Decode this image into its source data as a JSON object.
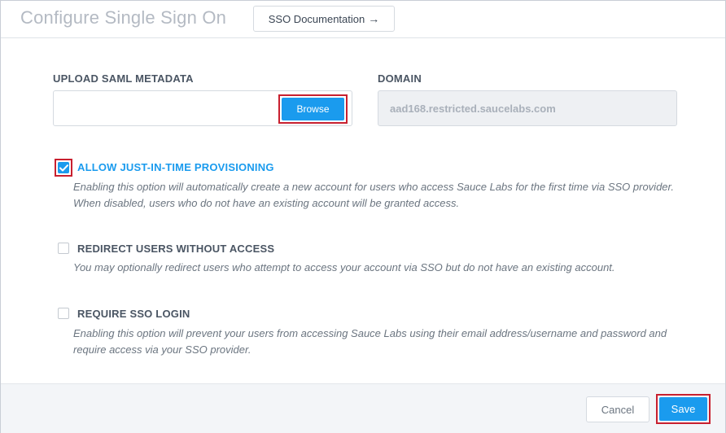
{
  "header": {
    "title": "Configure Single Sign On",
    "doc_button_label": "SSO Documentation"
  },
  "upload": {
    "label": "UPLOAD SAML METADATA",
    "browse_label": "Browse"
  },
  "domain": {
    "label": "DOMAIN",
    "value": "aad168.restricted.saucelabs.com"
  },
  "options": [
    {
      "title": "ALLOW JUST-IN-TIME PROVISIONING",
      "checked": true,
      "description": "Enabling this option will automatically create a new account for users who access Sauce Labs for the first time via SSO provider. When disabled, users who do not have an existing account will be granted access."
    },
    {
      "title": "REDIRECT USERS WITHOUT ACCESS",
      "checked": false,
      "description": "You may optionally redirect users who attempt to access your account via SSO but do not have an existing account."
    },
    {
      "title": "REQUIRE SSO LOGIN",
      "checked": false,
      "description": "Enabling this option will prevent your users from accessing Sauce Labs using their email address/username and password and require access via your SSO provider."
    }
  ],
  "footer": {
    "cancel_label": "Cancel",
    "save_label": "Save"
  },
  "colors": {
    "accent": "#1a9bee",
    "highlight": "#c8202f"
  }
}
